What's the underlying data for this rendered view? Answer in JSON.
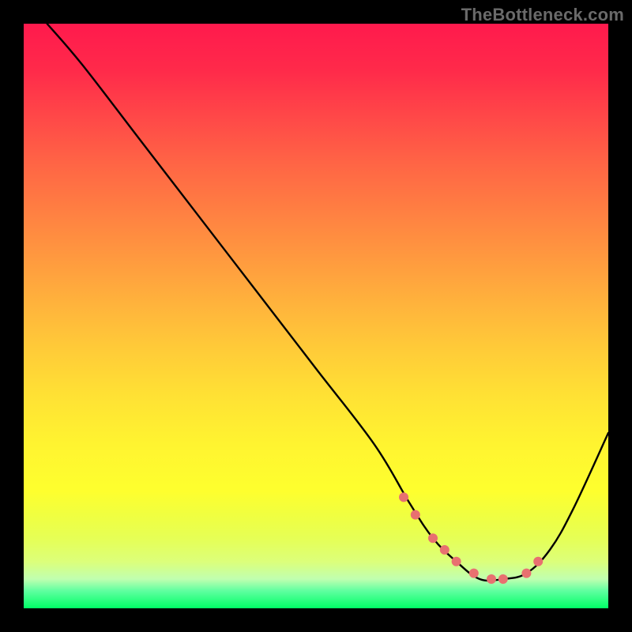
{
  "watermark": "TheBottleneck.com",
  "colors": {
    "curve": "#000000",
    "marker": "#e87070",
    "frame": "#000000"
  },
  "chart_data": {
    "type": "line",
    "title": "",
    "xlabel": "",
    "ylabel": "",
    "xlim": [
      0,
      100
    ],
    "ylim": [
      0,
      100
    ],
    "grid": false,
    "legend": false,
    "series": [
      {
        "name": "bottleneck-curve",
        "x": [
          4,
          10,
          20,
          30,
          40,
          50,
          60,
          66,
          70,
          74,
          78,
          82,
          86,
          90,
          94,
          100
        ],
        "y": [
          100,
          93,
          80,
          67,
          54,
          41,
          28,
          18,
          12,
          8,
          5,
          5,
          6,
          10,
          17,
          30
        ]
      }
    ],
    "markers": {
      "name": "highlight-dots",
      "x": [
        65,
        67,
        70,
        72,
        74,
        77,
        80,
        82,
        86,
        88
      ],
      "y": [
        19,
        16,
        12,
        10,
        8,
        6,
        5,
        5,
        6,
        8
      ]
    }
  }
}
